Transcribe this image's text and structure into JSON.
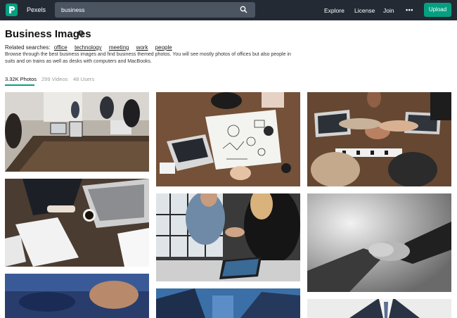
{
  "nav": {
    "brand": "Pexels",
    "search_value": "business",
    "links": [
      "Explore",
      "License",
      "Join"
    ],
    "more": "•••",
    "upload": "Upload"
  },
  "header": {
    "title": "Business Images",
    "related_label": "Related searches:",
    "related_tags": [
      "office",
      "technology",
      "meeting",
      "work",
      "people"
    ],
    "description": "Browse through the best business images and find business themed photos. You will see mostly photos of offices but also people in suits and on trains as well as desks with computers and MacBooks."
  },
  "tabs": [
    "3.32K Photos",
    "299 Videos",
    "48 Users"
  ],
  "colors": {
    "accent": "#05a081",
    "nav_bg": "#232a34",
    "search_bg": "#4b5461"
  },
  "photos": [
    "office-meeting-photo",
    "desk-teamwork-photo",
    "fist-bump-photo",
    "paperwork-laptop-photo",
    "handshake-office-photo",
    "handshake-bw-photo",
    "hands-blue-photo",
    "buildings-sky-photo",
    "suit-tie-photo"
  ]
}
